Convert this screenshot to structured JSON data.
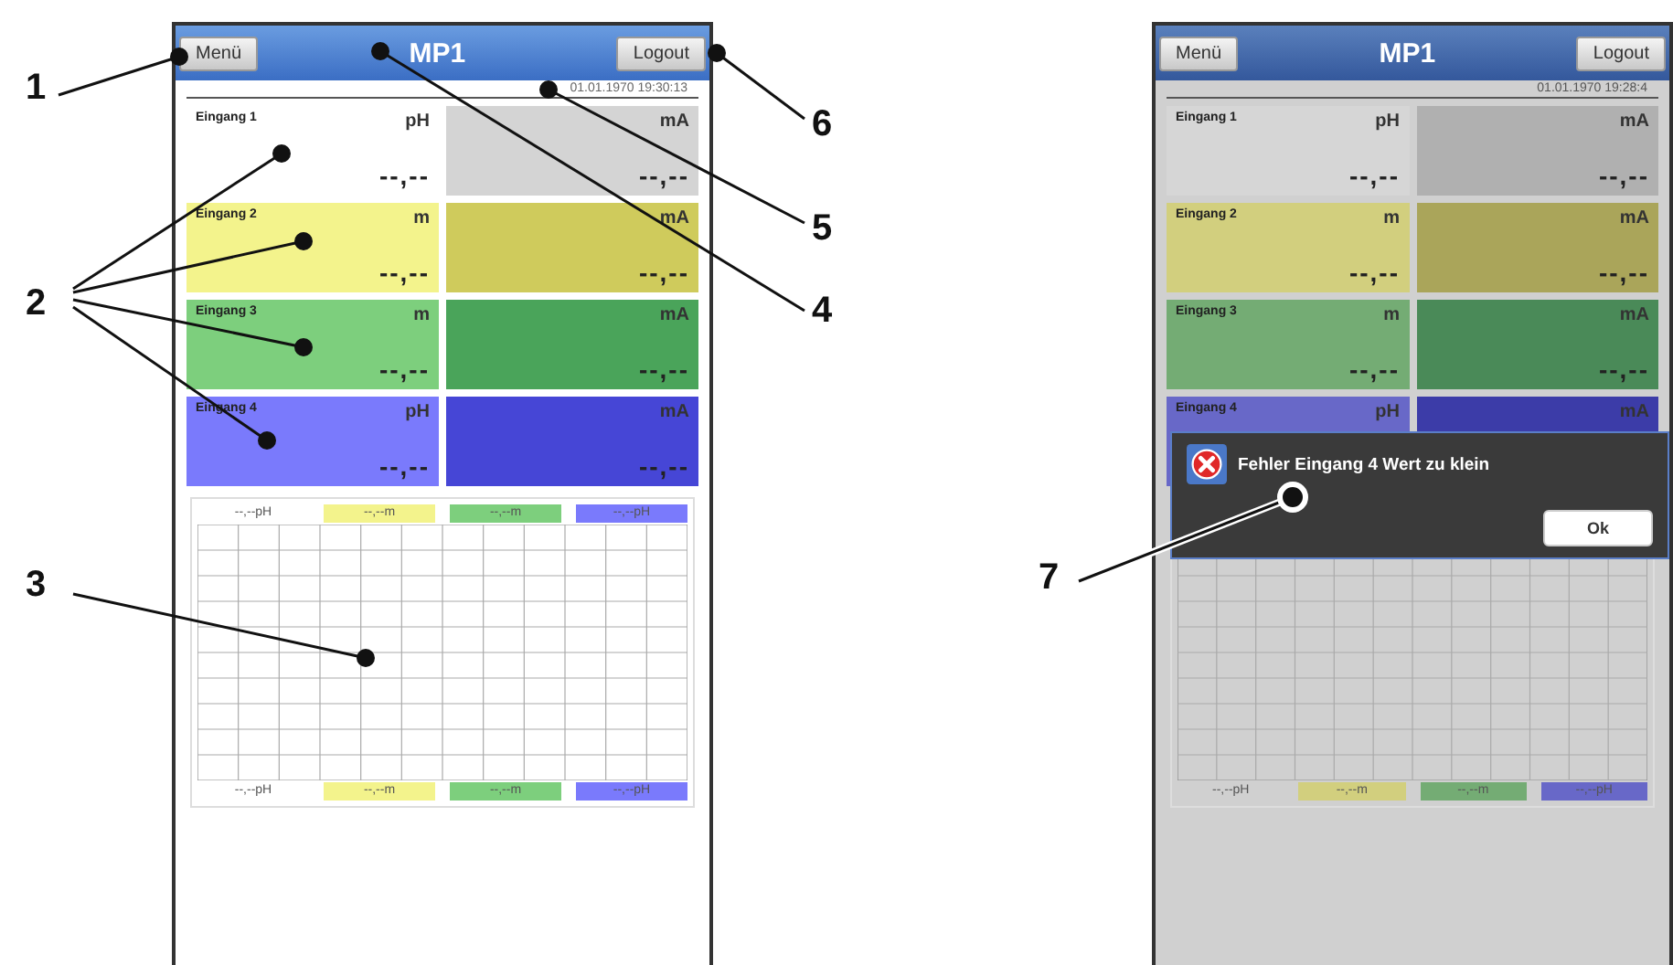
{
  "callouts": [
    {
      "number": "1"
    },
    {
      "number": "2"
    },
    {
      "number": "3"
    },
    {
      "number": "6"
    },
    {
      "number": "5"
    },
    {
      "number": "4"
    },
    {
      "number": "7"
    }
  ],
  "screens": [
    {
      "menu_button": "Menü",
      "title": "MP1",
      "logout_button": "Logout",
      "timestamp": "01.01.1970 19:30:13",
      "dimmed": false,
      "inputs": [
        {
          "label": "Eingang 1",
          "unit": "pH",
          "value": "--,--",
          "color": "#ffffff",
          "output": {
            "unit": "mA",
            "value": "--,--",
            "color": "#d4d4d4"
          }
        },
        {
          "label": "Eingang 2",
          "unit": "m",
          "value": "--,--",
          "color": "#f3f38c",
          "output": {
            "unit": "mA",
            "value": "--,--",
            "color": "#cfcb5c"
          }
        },
        {
          "label": "Eingang 3",
          "unit": "m",
          "value": "--,--",
          "color": "#7dcf7d",
          "output": {
            "unit": "mA",
            "value": "--,--",
            "color": "#4aa45a"
          }
        },
        {
          "label": "Eingang 4",
          "unit": "pH",
          "value": "--,--",
          "color": "#7a7afc",
          "output": {
            "unit": "mA",
            "value": "--,--",
            "color": "#4646d6"
          }
        }
      ],
      "chart": {
        "top_legend": [
          {
            "text": "--,--pH"
          },
          {
            "text": "--,--m",
            "color": "#f3f38c"
          },
          {
            "text": "--,--m",
            "color": "#7dcf7d"
          },
          {
            "text": "--,--pH",
            "color": "#7a7afc"
          }
        ],
        "bottom_legend": [
          {
            "text": "--,--pH"
          },
          {
            "text": "--,--m",
            "color": "#f3f38c"
          },
          {
            "text": "--,--m",
            "color": "#7dcf7d"
          },
          {
            "text": "--,--pH",
            "color": "#7a7afc"
          }
        ]
      }
    },
    {
      "menu_button": "Menü",
      "title": "MP1",
      "logout_button": "Logout",
      "timestamp": "01.01.1970 19:28:4",
      "dimmed": true,
      "inputs": [
        {
          "label": "Eingang 1",
          "unit": "pH",
          "value": "--,--",
          "color": "#d6d6d6",
          "output": {
            "unit": "mA",
            "value": "--,--",
            "color": "#b0b0b0"
          }
        },
        {
          "label": "Eingang 2",
          "unit": "m",
          "value": "--,--",
          "color": "#d2cf7e",
          "output": {
            "unit": "mA",
            "value": "--,--",
            "color": "#aaa55a"
          }
        },
        {
          "label": "Eingang 3",
          "unit": "m",
          "value": "--,--",
          "color": "#74ac74",
          "output": {
            "unit": "mA",
            "value": "--,--",
            "color": "#4a8a58"
          }
        },
        {
          "label": "Eingang 4",
          "unit": "pH",
          "color": "#6868c8",
          "output": {
            "unit": "mA",
            "color": "#3c3ca8"
          }
        }
      ],
      "chart": {
        "bottom_legend": [
          {
            "text": "--,--pH"
          },
          {
            "text": "--,--m",
            "color": "#d2cf7e"
          },
          {
            "text": "--,--m",
            "color": "#74ac74"
          },
          {
            "text": "--,--pH",
            "color": "#6868c8"
          }
        ]
      },
      "dialog": {
        "message": "Fehler Eingang 4 Wert zu klein",
        "button": "Ok"
      }
    }
  ]
}
